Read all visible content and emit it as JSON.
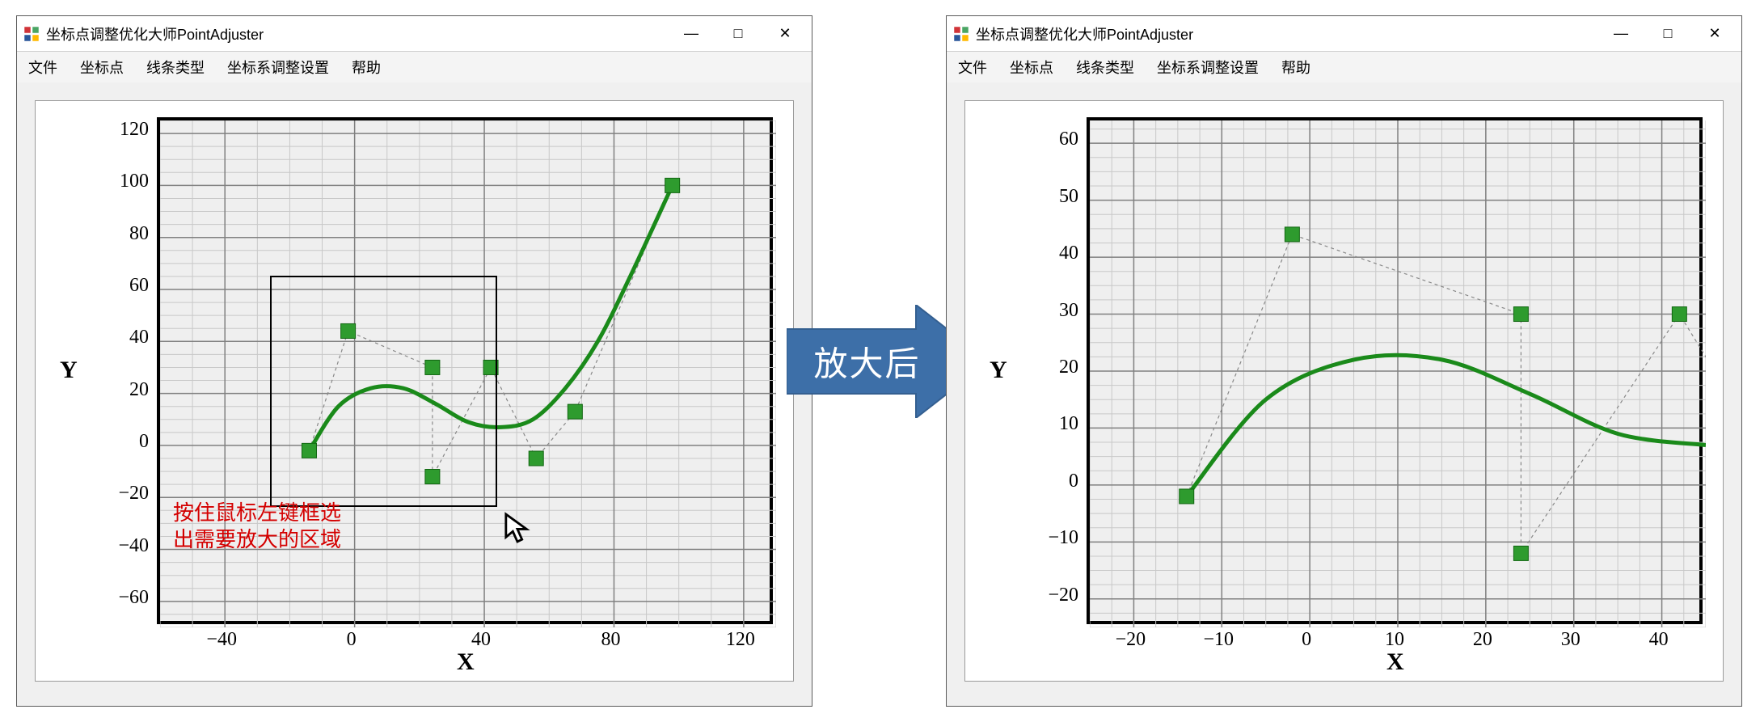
{
  "app": {
    "title": "坐标点调整优化大师PointAdjuster",
    "menu": [
      "文件",
      "坐标点",
      "线条类型",
      "坐标系调整设置",
      "帮助"
    ],
    "window_controls": {
      "minimize": "—",
      "maximize": "□",
      "close": "✕"
    }
  },
  "arrow_label": "放大后",
  "annotation": {
    "line1": "按住鼠标左键框选",
    "line2": "出需要放大的区域"
  },
  "chart_left": {
    "xlabel": "X",
    "ylabel": "Y",
    "x_ticks": [
      -40,
      0,
      40,
      80,
      120
    ],
    "y_ticks": [
      -60,
      -40,
      -20,
      0,
      20,
      40,
      60,
      80,
      100,
      120
    ],
    "xlim": [
      -60,
      130
    ],
    "ylim": [
      -70,
      125
    ],
    "selection_box": {
      "x0": -25,
      "x1": 45,
      "y0": -25,
      "y1": 64
    }
  },
  "chart_right": {
    "xlabel": "X",
    "ylabel": "Y",
    "x_ticks": [
      -20,
      -10,
      0,
      10,
      20,
      30,
      40
    ],
    "y_ticks": [
      -20,
      -10,
      0,
      10,
      20,
      30,
      40,
      50,
      60
    ],
    "xlim": [
      -25,
      45
    ],
    "ylim": [
      -25,
      64
    ]
  },
  "chart_data": {
    "type": "scatter",
    "xlabel": "X",
    "ylabel": "Y",
    "title": "",
    "series": [
      {
        "name": "control-points",
        "style": "square-markers-with-polyline",
        "points": [
          {
            "x": -14,
            "y": -2
          },
          {
            "x": -2,
            "y": 44
          },
          {
            "x": 24,
            "y": 30
          },
          {
            "x": 24,
            "y": -12
          },
          {
            "x": 42,
            "y": 30
          },
          {
            "x": 56,
            "y": -5
          },
          {
            "x": 68,
            "y": 13
          },
          {
            "x": 98,
            "y": 100
          }
        ]
      },
      {
        "name": "spline-curve",
        "style": "smooth-green-curve",
        "points": [
          {
            "x": -14,
            "y": -2
          },
          {
            "x": -5,
            "y": 15
          },
          {
            "x": 5,
            "y": 22
          },
          {
            "x": 15,
            "y": 22
          },
          {
            "x": 25,
            "y": 16
          },
          {
            "x": 35,
            "y": 9
          },
          {
            "x": 45,
            "y": 7
          },
          {
            "x": 55,
            "y": 10
          },
          {
            "x": 65,
            "y": 22
          },
          {
            "x": 75,
            "y": 40
          },
          {
            "x": 85,
            "y": 65
          },
          {
            "x": 98,
            "y": 100
          }
        ]
      }
    ]
  }
}
